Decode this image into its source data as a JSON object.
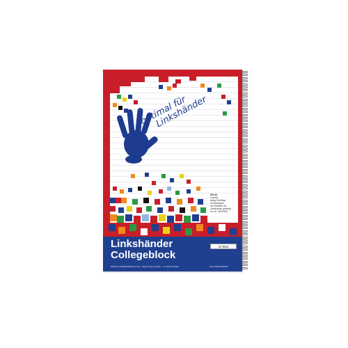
{
  "product": {
    "title_line1": "Linkshänder",
    "title_line2": "Collegeblock",
    "slogan_line1": "optimal für",
    "slogan_line2": "Linkshänder",
    "format": "DIN A4",
    "info_lines": [
      "Lineatur",
      "farbig Schrifttyp",
      "Schreibpapier",
      "mit Hilfslinien für",
      "Linkshänder gefertigt",
      "Art.-Nr. 00000000"
    ],
    "sheet_count": "80 Blatt",
    "publisher": "MARKLIN PAPIERWAREN GmbH · Robert-Mayer-Straße 1 · D-70191 Stuttgart",
    "article_code": "EAN 4006144000000"
  },
  "colors": {
    "cover_red": "#c81e2a",
    "band_blue": "#1f3f8f",
    "hand_blue": "#1e3c8f",
    "pixel_palette": [
      "#1f3f8f",
      "#f08a1c",
      "#2a9a45",
      "#e7d21a",
      "#111111",
      "#8fb6e6",
      "#ffffff",
      "#c81e2a"
    ]
  },
  "icons": {
    "handprint": "handprint-icon",
    "spiral": "spiral-binding-icon"
  }
}
